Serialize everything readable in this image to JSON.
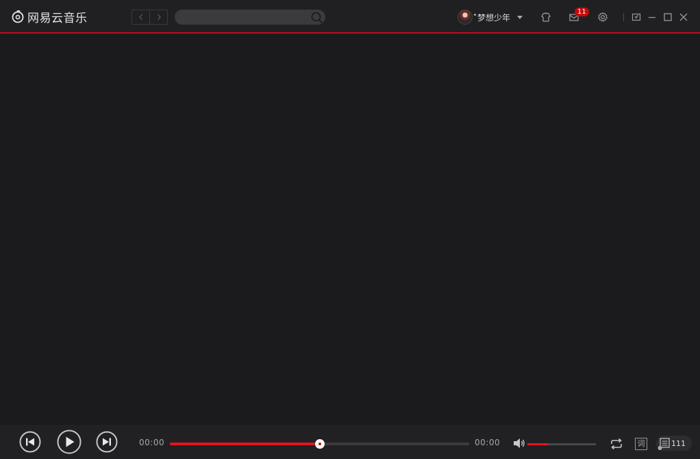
{
  "app": {
    "logo_text": "网易云音乐",
    "accent_color": "#c20c0c"
  },
  "header": {
    "nav_back_icon": "chevron-left-icon",
    "nav_forward_icon": "chevron-right-icon",
    "search": {
      "placeholder": "",
      "value": "",
      "icon": "search-icon"
    },
    "user": {
      "name": "梦想少年",
      "caret_icon": "caret-down-icon"
    },
    "skin_icon": "tshirt-icon",
    "message": {
      "icon": "mail-icon",
      "badge": "11"
    },
    "settings_icon": "gear-icon",
    "window_controls": [
      "mini-mode-icon",
      "minimize-icon",
      "maximize-icon",
      "close-icon"
    ]
  },
  "player": {
    "prev_icon": "previous-icon",
    "play_icon": "play-icon",
    "next_icon": "next-icon",
    "current_time": "00:00",
    "total_time": "00:00",
    "progress_percent": 50,
    "volume_percent": 30,
    "volume_icon": "volume-icon",
    "loop_icon": "loop-icon",
    "lyric_label": "词",
    "playlist_icon": "playlist-icon",
    "playlist_count": "111"
  }
}
